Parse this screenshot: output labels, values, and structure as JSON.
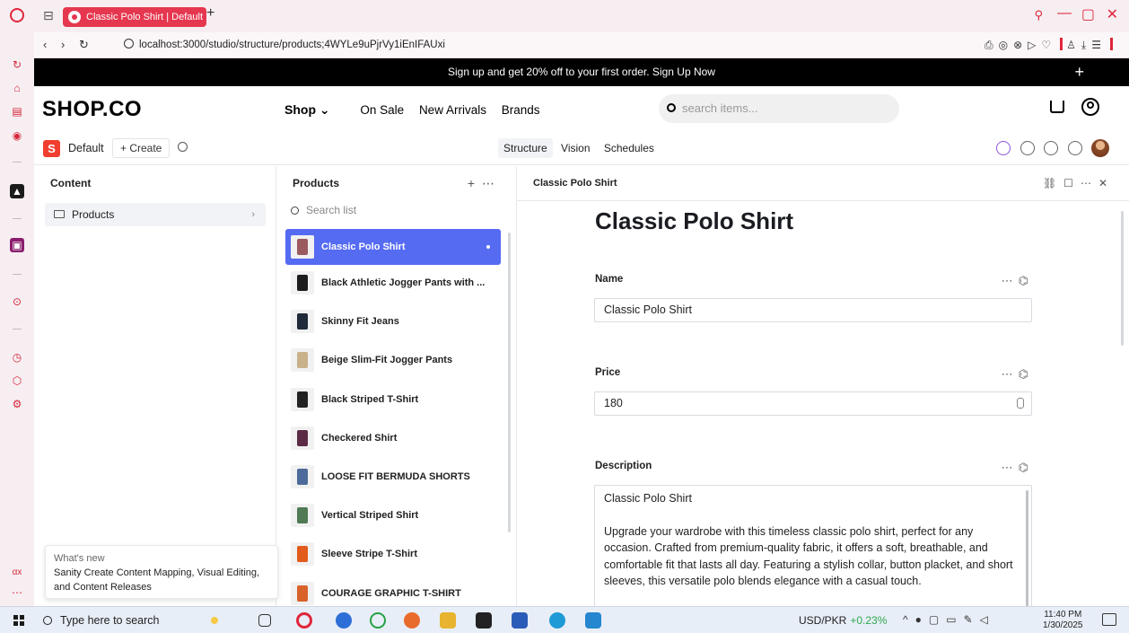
{
  "browser": {
    "tab_title": "Classic Polo Shirt | Default",
    "url": "localhost:3000/studio/structure/products;4WYLe9uPjrVy1iEnIFAUxi",
    "accent": "#e5374f"
  },
  "promo": {
    "text": "Sign up and get 20% off to your first order.  Sign Up Now"
  },
  "shop_header": {
    "brand": "SHOP.CO",
    "nav": [
      "Shop ⌄",
      "On Sale",
      "New Arrivals",
      "Brands"
    ],
    "search_placeholder": "search items..."
  },
  "studio": {
    "workspace": "Default",
    "create_label": "+ Create",
    "tool_tabs": [
      "Structure",
      "Vision",
      "Schedules"
    ],
    "active_tool": "Structure"
  },
  "content_pane": {
    "title": "Content",
    "items": [
      {
        "label": "Products"
      }
    ]
  },
  "products_pane": {
    "title": "Products",
    "search_placeholder": "Search list",
    "items": [
      {
        "label": "Classic Polo Shirt",
        "selected": true,
        "thumb_color": "#9a5a5e"
      },
      {
        "label": "Black Athletic Jogger Pants with ...",
        "thumb_color": "#1c1c1c"
      },
      {
        "label": "Skinny Fit Jeans",
        "thumb_color": "#1f2a3a"
      },
      {
        "label": "Beige Slim-Fit Jogger Pants",
        "thumb_color": "#c9b28a"
      },
      {
        "label": "Black Striped T-Shirt",
        "thumb_color": "#222"
      },
      {
        "label": "Checkered Shirt",
        "thumb_color": "#5b2b45"
      },
      {
        "label": "LOOSE FIT BERMUDA SHORTS",
        "thumb_color": "#4c6a9a"
      },
      {
        "label": "Vertical Striped Shirt",
        "thumb_color": "#4f7a55"
      },
      {
        "label": "Sleeve Stripe T-Shirt",
        "thumb_color": "#e25a1c"
      },
      {
        "label": "COURAGE GRAPHIC T-SHIRT",
        "thumb_color": "#d9622b"
      }
    ]
  },
  "document": {
    "header": "Classic Polo Shirt",
    "title": "Classic Polo Shirt",
    "fields": {
      "name": {
        "label": "Name",
        "value": "Classic Polo Shirt"
      },
      "price": {
        "label": "Price",
        "value": "180"
      },
      "description": {
        "label": "Description",
        "line1": "Classic Polo Shirt",
        "line2": "Upgrade your wardrobe with this timeless classic polo shirt, perfect for any occasion. Crafted from premium-quality fabric, it offers a soft, breathable, and comfortable fit that lasts all day. Featuring a stylish collar, button placket, and short sleeves, this versatile polo blends elegance with a casual touch."
      }
    }
  },
  "whats_new": {
    "title": "What's new",
    "body": "Sanity Create Content Mapping, Visual Editing, and Content Releases"
  },
  "taskbar": {
    "search_placeholder": "Type here to search",
    "currency": "USD/PKR",
    "currency_change": "+0.23%",
    "time": "11:40 PM",
    "date": "1/30/2025"
  }
}
